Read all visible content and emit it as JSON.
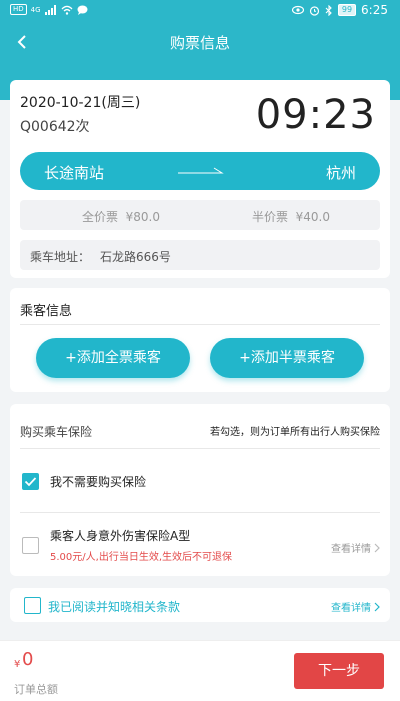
{
  "status_bar": {
    "time": "6:25",
    "battery": "99",
    "network": "HD",
    "signal_tag": "4G"
  },
  "nav": {
    "title": "购票信息"
  },
  "ticket": {
    "date": "2020-10-21(周三)",
    "train_no": "Q00642次",
    "departure_time": "09:23",
    "from_station": "长途南站",
    "to_station": "杭州",
    "full_price_label": "全价票",
    "full_price": "¥80.0",
    "half_price_label": "半价票",
    "half_price": "¥40.0",
    "address_label": "乘车地址：",
    "address": "石龙路666号"
  },
  "passengers": {
    "title": "乘客信息",
    "add_full_label": "+添加全票乘客",
    "add_half_label": "+添加半票乘客"
  },
  "insurance": {
    "title": "购买乘车保险",
    "hint": "若勾选，则为订单所有出行人购买保险",
    "none_option": "我不需要购买保险",
    "none_checked": true,
    "plan_name": "乘客人身意外伤害保险A型",
    "plan_desc": "5.00元/人,出行当日生效,生效后不可退保",
    "plan_checked": false,
    "detail_label": "查看详情"
  },
  "terms": {
    "label": "我已阅读并知晓相关条款",
    "detail_label": "查看详情",
    "checked": false
  },
  "footer": {
    "currency": "¥",
    "total": "0",
    "total_label": "订单总额",
    "next_label": "下一步"
  },
  "colors": {
    "accent": "#22b6cb",
    "header": "#2cb7c9",
    "danger": "#e24646"
  }
}
